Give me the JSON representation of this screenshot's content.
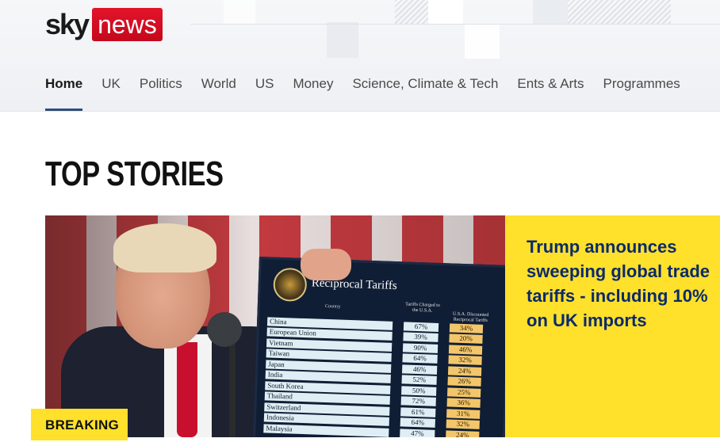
{
  "header": {
    "logo_sky": "sky",
    "logo_news": "news",
    "nav": [
      {
        "label": "Home",
        "active": true
      },
      {
        "label": "UK",
        "active": false
      },
      {
        "label": "Politics",
        "active": false
      },
      {
        "label": "World",
        "active": false
      },
      {
        "label": "US",
        "active": false
      },
      {
        "label": "Money",
        "active": false
      },
      {
        "label": "Science, Climate & Tech",
        "active": false
      },
      {
        "label": "Ents & Arts",
        "active": false
      },
      {
        "label": "Programmes",
        "active": false
      }
    ]
  },
  "section": {
    "title": "TOP STORIES"
  },
  "lead_story": {
    "badge": "BREAKING",
    "headline": "Trump announces\nsweeping global trade\ntariffs - including 10%\non UK imports",
    "board": {
      "title": "Reciprocal Tariffs",
      "col_country": "Country",
      "col_charged": "Tariffs Charged to the U.S.A.",
      "col_discounted": "U.S.A. Discounted Reciprocal Tariffs",
      "rows": [
        {
          "country": "China",
          "charged": "67%",
          "discounted": "34%"
        },
        {
          "country": "European Union",
          "charged": "39%",
          "discounted": "20%"
        },
        {
          "country": "Vietnam",
          "charged": "90%",
          "discounted": "46%"
        },
        {
          "country": "Taiwan",
          "charged": "64%",
          "discounted": "32%"
        },
        {
          "country": "Japan",
          "charged": "46%",
          "discounted": "24%"
        },
        {
          "country": "India",
          "charged": "52%",
          "discounted": "26%"
        },
        {
          "country": "South Korea",
          "charged": "50%",
          "discounted": "25%"
        },
        {
          "country": "Thailand",
          "charged": "72%",
          "discounted": "36%"
        },
        {
          "country": "Switzerland",
          "charged": "61%",
          "discounted": "31%"
        },
        {
          "country": "Indonesia",
          "charged": "64%",
          "discounted": "32%"
        },
        {
          "country": "Malaysia",
          "charged": "47%",
          "discounted": "24%"
        }
      ]
    }
  },
  "colors": {
    "brand_red": "#d0112b",
    "accent_yellow": "#ffe02b",
    "headline_blue": "#0b2a6b",
    "nav_underline": "#314d7a"
  }
}
